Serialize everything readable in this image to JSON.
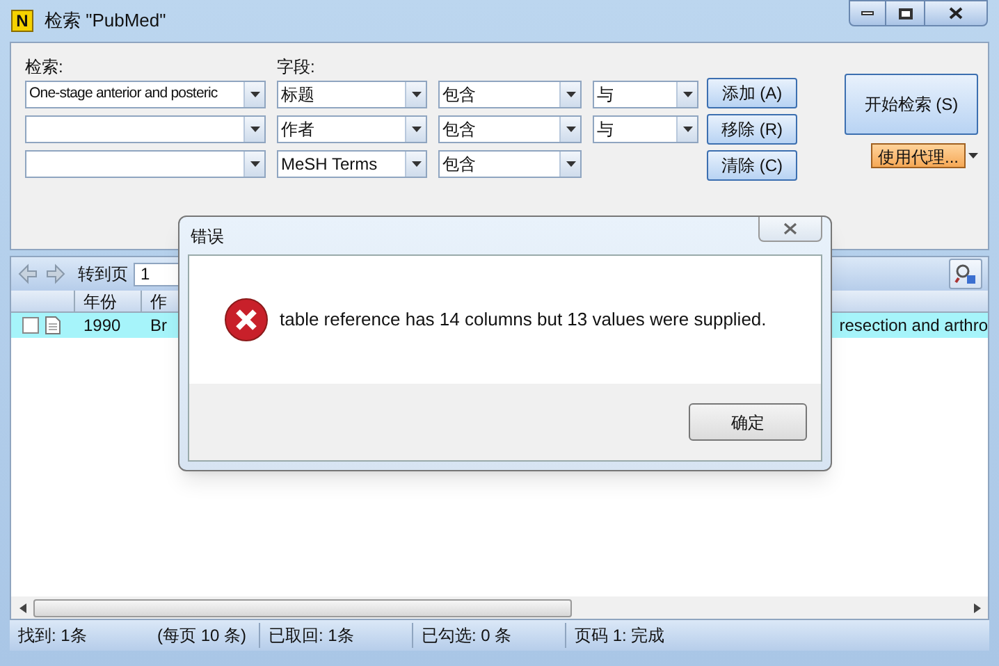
{
  "window": {
    "title": "检索 \"PubMed\"",
    "app_letter": "N"
  },
  "search": {
    "query_label": "检索:",
    "field_label": "字段:",
    "rows": [
      {
        "query": "One-stage anterior and posteric",
        "field": "标题",
        "condition": "包含",
        "operator": "与"
      },
      {
        "query": "",
        "field": "作者",
        "condition": "包含",
        "operator": "与"
      },
      {
        "query": "",
        "field": "MeSH Terms",
        "condition": "包含"
      }
    ],
    "buttons": [
      "添加 (A)",
      "移除 (R)",
      "清除 (C)"
    ],
    "start_button": "开始检索 (S)",
    "proxy_button": "使用代理..."
  },
  "toolbar": {
    "goto_label": "转到页",
    "page": "1"
  },
  "table": {
    "columns": [
      "年份",
      "作"
    ],
    "rows": [
      {
        "checked": false,
        "selected": true,
        "year": "1990",
        "author": "Br",
        "title": "resection and arthro"
      }
    ]
  },
  "status_bar": [
    "找到: 1条",
    "(每页 10 条)",
    "已取回: 1条",
    "已勾选: 0 条",
    "页码 1: 完成"
  ],
  "dialog": {
    "title": "错误",
    "message": "table reference has 14 columns but 13 values were supplied.",
    "ok": "确定"
  }
}
